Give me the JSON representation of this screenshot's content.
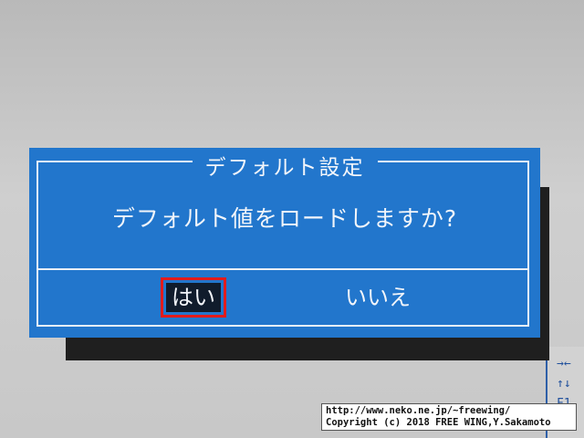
{
  "dialog": {
    "title": "デフォルト設定",
    "message": "デフォルト値をロードしますか?",
    "buttons": {
      "yes": "はい",
      "no": "いいえ"
    },
    "selected": "yes"
  },
  "side_panel": {
    "arrows": "→←\n↑↓\nF1"
  },
  "credit": {
    "line1": "http://www.neko.ne.jp/~freewing/",
    "line2": "Copyright (c) 2018 FREE WING,Y.Sakamoto"
  },
  "colors": {
    "dialog_bg": "#2276cc",
    "selection_outline": "#e21b1b",
    "shadow": "#1f1f1f"
  }
}
